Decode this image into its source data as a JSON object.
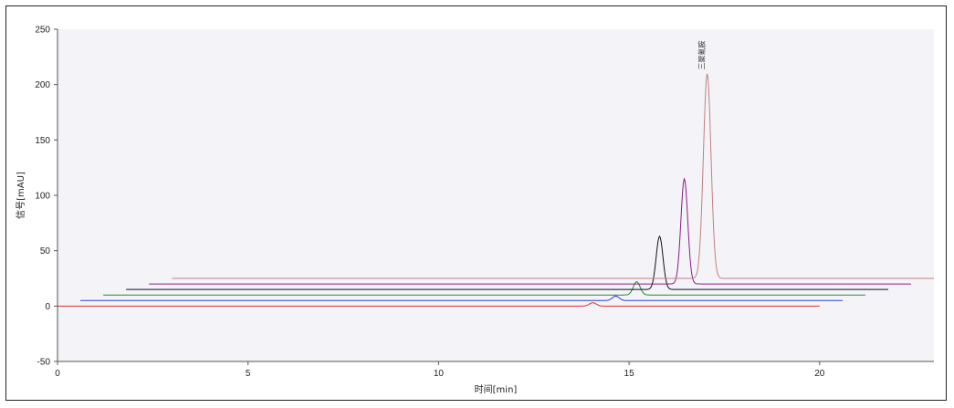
{
  "chart_data": {
    "type": "line",
    "title": "",
    "xlabel": "时间[min]",
    "ylabel": "信号[mAU]",
    "xlim": [
      0,
      23
    ],
    "ylim": [
      -50,
      250
    ],
    "x_ticks": [
      0,
      5,
      10,
      15,
      20
    ],
    "y_ticks": [
      -50,
      0,
      50,
      100,
      150,
      200,
      250
    ],
    "grid": false,
    "annotation": {
      "text": "三聚氰胺",
      "x": 17.05,
      "y": 210
    },
    "series": [
      {
        "color": "#e03030",
        "x_start": 0.0,
        "x_end": 20.0,
        "baseline": 0,
        "peaks": [
          {
            "t": 14.05,
            "h": 3,
            "w": 0.09
          }
        ]
      },
      {
        "color": "#2c3fcc",
        "x_start": 0.6,
        "x_end": 20.6,
        "baseline": 5,
        "peaks": [
          {
            "t": 14.65,
            "h": 4,
            "w": 0.09
          }
        ]
      },
      {
        "color": "#1f8a3a",
        "x_start": 1.2,
        "x_end": 21.2,
        "baseline": 10,
        "peaks": [
          {
            "t": 15.2,
            "h": 12,
            "w": 0.09
          }
        ]
      },
      {
        "color": "#111111",
        "x_start": 1.8,
        "x_end": 21.8,
        "baseline": 15,
        "peaks": [
          {
            "t": 15.8,
            "h": 48,
            "w": 0.09
          }
        ]
      },
      {
        "color": "#8b1a8b",
        "x_start": 2.4,
        "x_end": 22.4,
        "baseline": 20,
        "peaks": [
          {
            "t": 16.45,
            "h": 95,
            "w": 0.09
          }
        ]
      },
      {
        "color": "#c08080",
        "x_start": 3.0,
        "x_end": 23.0,
        "baseline": 25,
        "peaks": [
          {
            "t": 17.05,
            "h": 185,
            "w": 0.1
          }
        ]
      }
    ]
  }
}
